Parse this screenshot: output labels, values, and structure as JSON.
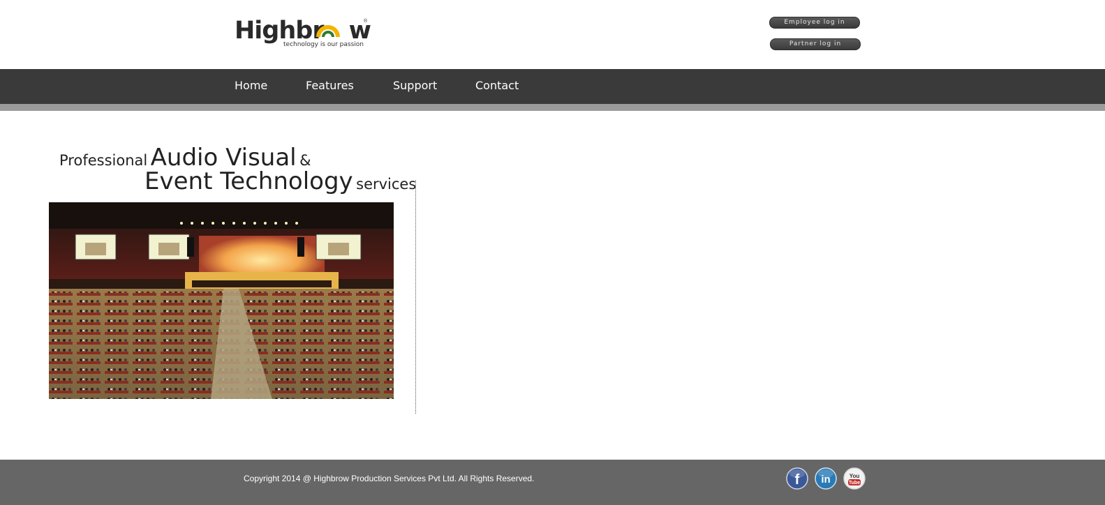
{
  "header": {
    "logo": {
      "wordmark_start": "Highbr",
      "wordmark_end": "w",
      "tagline": "technology is our passion",
      "registered": "®",
      "colors": {
        "ring_yellow": "#f4b400",
        "ring_green": "#2f7d32",
        "ink": "#2a2a2a"
      }
    },
    "employee_login_label": "Employee log in",
    "partner_login_label": "Partner log in"
  },
  "nav": {
    "items": [
      {
        "label": "Home"
      },
      {
        "label": "Features"
      },
      {
        "label": "Support"
      },
      {
        "label": "Contact"
      }
    ],
    "bar_color": "#3a3a3a",
    "strip_color": "#9c9c9c"
  },
  "hero": {
    "line1_small": "Professional",
    "line1_big": "Audio Visual",
    "line1_amp": "&",
    "line2_big": "Event Technology",
    "line2_small": "services",
    "photo": {
      "icon": "conference-hall-photo"
    }
  },
  "footer": {
    "copyright": "Copyright 2014 @ Highbrow Production Services Pvt Ltd. All Rights Reserved.",
    "social": [
      {
        "icon": "facebook-icon",
        "glyph": "f",
        "color": "#3b5998"
      },
      {
        "icon": "linkedin-icon",
        "glyph": "in",
        "color": "#2a7ab6"
      },
      {
        "icon": "youtube-icon",
        "glyph_top": "You",
        "glyph_bottom": "Tube",
        "color": "#c4302b"
      }
    ],
    "background": "#666666"
  }
}
